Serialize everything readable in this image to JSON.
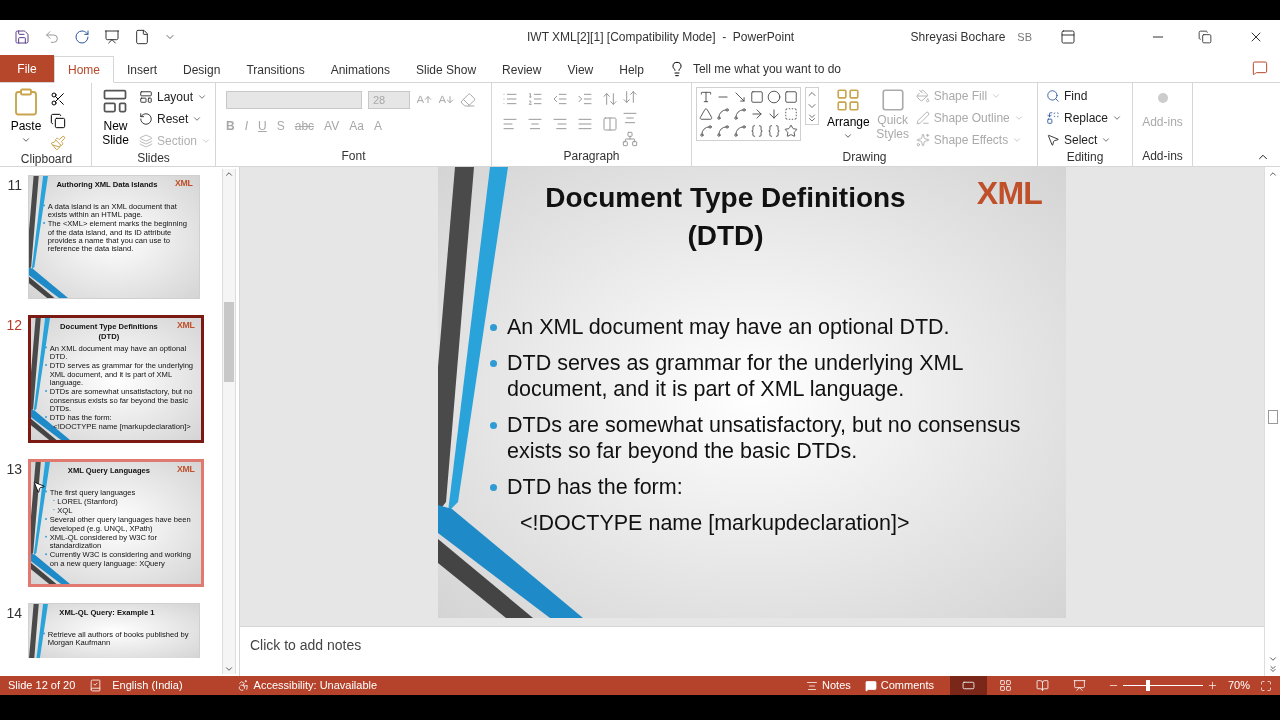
{
  "window": {
    "title": "IWT XML[2][1] [Compatibility Mode]  -  PowerPoint",
    "user_name": "Shreyasi Bochare",
    "user_initials": "SB"
  },
  "tabs": [
    {
      "label": "File",
      "kind": "file",
      "selected": false
    },
    {
      "label": "Home",
      "kind": "tab",
      "selected": true
    },
    {
      "label": "Insert",
      "kind": "tab",
      "selected": false
    },
    {
      "label": "Design",
      "kind": "tab",
      "selected": false
    },
    {
      "label": "Transitions",
      "kind": "tab",
      "selected": false
    },
    {
      "label": "Animations",
      "kind": "tab",
      "selected": false
    },
    {
      "label": "Slide Show",
      "kind": "tab",
      "selected": false
    },
    {
      "label": "Review",
      "kind": "tab",
      "selected": false
    },
    {
      "label": "View",
      "kind": "tab",
      "selected": false
    },
    {
      "label": "Help",
      "kind": "tab",
      "selected": false
    }
  ],
  "tell_me": "Tell me what you want to do",
  "ribbon": [
    {
      "kind": "clipboard",
      "label": "Clipboard",
      "paste": "Paste"
    },
    {
      "kind": "slides",
      "label": "Slides",
      "new_slide": "New Slide",
      "items": [
        {
          "label": "Layout",
          "disabled": false
        },
        {
          "label": "Reset",
          "disabled": false
        },
        {
          "label": "Section",
          "disabled": true
        }
      ]
    },
    {
      "kind": "font",
      "label": "Font",
      "font_size": "28",
      "disabled": true,
      "buttons": [
        "B",
        "I",
        "U",
        "S",
        "abc",
        "AV",
        "Aa",
        "A"
      ]
    },
    {
      "kind": "paragraph",
      "label": "Paragraph"
    },
    {
      "kind": "drawing",
      "label": "Drawing",
      "arrange": "Arrange",
      "quick_styles": {
        "label": "Quick Styles",
        "disabled": true
      },
      "items": [
        {
          "label": "Shape Fill",
          "disabled": true
        },
        {
          "label": "Shape Outline",
          "disabled": true
        },
        {
          "label": "Shape Effects",
          "disabled": true
        }
      ]
    },
    {
      "kind": "editing",
      "label": "Editing",
      "items": [
        "Find",
        "Replace",
        "Select"
      ]
    },
    {
      "kind": "addins",
      "label": "Add-ins",
      "button": {
        "label": "Add-ins",
        "disabled": true
      }
    }
  ],
  "thumbnails": [
    {
      "number": "11",
      "selected": false,
      "hovered": false,
      "title": "Authoring XML Data Islands",
      "logo": "XML",
      "bullets": [
        {
          "kind": "bullet",
          "text": "A data island is an XML document that exists within an HTML page."
        },
        {
          "kind": "bullet",
          "text": "The <XML> element marks the beginning of the data island, and its ID attribute provides a name that you can use to reference the data island."
        }
      ]
    },
    {
      "number": "12",
      "selected": true,
      "hovered": false,
      "title": "Document Type Definitions (DTD)",
      "logo": "XML",
      "bullets": [
        {
          "kind": "bullet",
          "text": "An XML document may have an optional DTD."
        },
        {
          "kind": "bullet",
          "text": "DTD serves as grammar for the underlying XML document, and it is part of XML language."
        },
        {
          "kind": "bullet",
          "text": "DTDs are somewhat unsatisfactory, but no consensus exists so far beyond the basic DTDs."
        },
        {
          "kind": "bullet",
          "text": "DTD has the form:"
        },
        {
          "kind": "plain",
          "text": "<!DOCTYPE name [markupdeclaration]>"
        }
      ]
    },
    {
      "number": "13",
      "selected": false,
      "hovered": true,
      "title": "XML Query Languages",
      "logo": "XML",
      "bullets": [
        {
          "kind": "bullet",
          "text": "The first query languages"
        },
        {
          "kind": "sub",
          "text": "LOREL (Stanford)"
        },
        {
          "kind": "sub",
          "text": "XQL"
        },
        {
          "kind": "bullet",
          "text": "Several other query languages have been developed (e.g. UNQL, XPath)"
        },
        {
          "kind": "bullet",
          "text": "XML-QL considered by W3C for standardization"
        },
        {
          "kind": "bullet",
          "text": "Currently W3C is considering and working on a new query language: XQuery"
        }
      ]
    },
    {
      "number": "14",
      "selected": false,
      "hovered": false,
      "title": "XML-QL Query: Example 1",
      "bullets": [
        {
          "kind": "bullet",
          "text": "Retrieve all authors of books published by Morgan Kaufmann"
        }
      ]
    }
  ],
  "slide": {
    "title": "Document Type Definitions (DTD)",
    "logo": "XML",
    "bullets": [
      {
        "kind": "bullet",
        "text": "An XML document may have an optional DTD."
      },
      {
        "kind": "bullet",
        "text": "DTD serves as grammar for the underlying XML document, and it is part of XML language."
      },
      {
        "kind": "bullet",
        "text": "DTDs are somewhat unsatisfactory, but no consensus exists so far beyond the basic DTDs."
      },
      {
        "kind": "bullet",
        "text": "DTD has the form:"
      },
      {
        "kind": "plain",
        "text": "<!DOCTYPE name [markupdeclaration]>"
      }
    ]
  },
  "notes": {
    "placeholder": "Click to add notes"
  },
  "status_bar": {
    "slide": "Slide 12 of 20",
    "language": "English (India)",
    "accessibility": "Accessibility: Unavailable",
    "notes": "Notes",
    "comments": "Comments",
    "views": [
      {
        "kind": "normal",
        "selected": true
      },
      {
        "kind": "sorter",
        "selected": false
      },
      {
        "kind": "reading",
        "selected": false
      },
      {
        "kind": "slideshow",
        "selected": false
      }
    ],
    "zoom": {
      "level": 0.3,
      "reading": "70%"
    }
  }
}
